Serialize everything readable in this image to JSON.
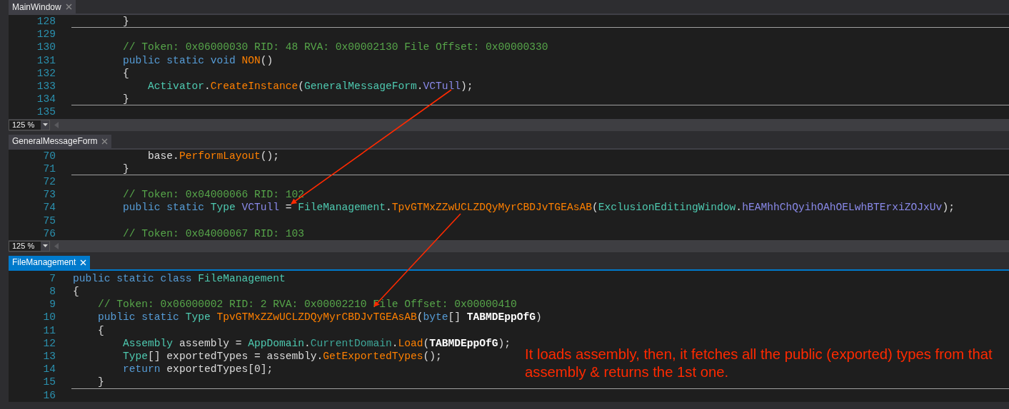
{
  "panels": [
    {
      "tab": {
        "label": "MainWindow",
        "selected": false
      },
      "zoom": "125 %",
      "lines": [
        {
          "number": "128",
          "divider": true,
          "code": [
            {
              "kind": "plain",
              "text": "        }"
            }
          ]
        },
        {
          "number": "129",
          "divider": false
        },
        {
          "number": "130",
          "divider": false,
          "code": [
            {
              "kind": "comment",
              "text": "        // Token: 0x06000030 RID: 48 RVA: 0x00002130 File Offset: 0x00000330"
            }
          ]
        },
        {
          "number": "131",
          "divider": false,
          "code": [
            {
              "kind": "keyword",
              "text": "        public static void "
            },
            {
              "kind": "method",
              "text": "NON"
            },
            {
              "kind": "plain",
              "text": "()"
            }
          ]
        },
        {
          "number": "132",
          "divider": false,
          "code": [
            {
              "kind": "plain",
              "text": "        {"
            }
          ]
        },
        {
          "number": "133",
          "divider": false,
          "code": [
            {
              "kind": "type",
              "text": "            Activator"
            },
            {
              "kind": "plain",
              "text": "."
            },
            {
              "kind": "method",
              "text": "CreateInstance"
            },
            {
              "kind": "plain",
              "text": "("
            },
            {
              "kind": "type",
              "text": "GeneralMessageForm"
            },
            {
              "kind": "plain",
              "text": "."
            },
            {
              "kind": "field",
              "text": "VCTull"
            },
            {
              "kind": "plain",
              "text": ");"
            }
          ]
        },
        {
          "number": "134",
          "divider": true,
          "code": [
            {
              "kind": "plain",
              "text": "        }"
            }
          ]
        },
        {
          "number": "135",
          "divider": false
        }
      ]
    },
    {
      "tab": {
        "label": "GeneralMessageForm",
        "selected": false
      },
      "zoom": "125 %",
      "lines": [
        {
          "number": "70",
          "divider": false,
          "code": [
            {
              "kind": "plain",
              "text": "            base."
            },
            {
              "kind": "method",
              "text": "PerformLayout"
            },
            {
              "kind": "plain",
              "text": "();"
            }
          ]
        },
        {
          "number": "71",
          "divider": true,
          "code": [
            {
              "kind": "plain",
              "text": "        }"
            }
          ]
        },
        {
          "number": "72",
          "divider": false
        },
        {
          "number": "73",
          "divider": false,
          "code": [
            {
              "kind": "comment",
              "text": "        // Token: 0x04000066 RID: 102"
            }
          ]
        },
        {
          "number": "74",
          "divider": false,
          "code": [
            {
              "kind": "keyword",
              "text": "        public static "
            },
            {
              "kind": "type",
              "text": "Type "
            },
            {
              "kind": "field",
              "text": "VCTull"
            },
            {
              "kind": "plain",
              "text": " = "
            },
            {
              "kind": "type",
              "text": "FileManagement"
            },
            {
              "kind": "plain",
              "text": "."
            },
            {
              "kind": "method",
              "text": "TpvGTMxZZwUCLZDQyMyrCBDJvTGEAsAB"
            },
            {
              "kind": "plain",
              "text": "("
            },
            {
              "kind": "type",
              "text": "ExclusionEditingWindow"
            },
            {
              "kind": "plain",
              "text": "."
            },
            {
              "kind": "field",
              "text": "hEAMhhChQyihOAhOELwhBTErxiZOJxUv"
            },
            {
              "kind": "plain",
              "text": ");"
            }
          ]
        },
        {
          "number": "75",
          "divider": false
        },
        {
          "number": "76",
          "divider": false,
          "code": [
            {
              "kind": "comment",
              "text": "        // Token: 0x04000067 RID: 103"
            }
          ]
        }
      ]
    },
    {
      "tab": {
        "label": "FileManagement",
        "selected": true
      },
      "lines": [
        {
          "number": "7",
          "divider": false,
          "code": [
            {
              "kind": "keyword",
              "text": "public static class "
            },
            {
              "kind": "type",
              "text": "FileManagement"
            }
          ]
        },
        {
          "number": "8",
          "divider": false,
          "code": [
            {
              "kind": "plain",
              "text": "{"
            }
          ]
        },
        {
          "number": "9",
          "divider": false,
          "code": [
            {
              "kind": "comment",
              "text": "    // Token: 0x06000002 RID: 2 RVA: 0x00002210 File Offset: 0x00000410"
            }
          ]
        },
        {
          "number": "10",
          "divider": false,
          "code": [
            {
              "kind": "keyword",
              "text": "    public static "
            },
            {
              "kind": "type",
              "text": "Type "
            },
            {
              "kind": "method",
              "text": "TpvGTMxZZwUCLZDQyMyrCBDJvTGEAsAB"
            },
            {
              "kind": "plain",
              "text": "("
            },
            {
              "kind": "keyword",
              "text": "byte"
            },
            {
              "kind": "plain",
              "text": "[] "
            },
            {
              "kind": "param",
              "text": "TABMDEppOfG"
            },
            {
              "kind": "plain",
              "text": ")"
            }
          ]
        },
        {
          "number": "11",
          "divider": false,
          "code": [
            {
              "kind": "plain",
              "text": "    {"
            }
          ]
        },
        {
          "number": "12",
          "divider": false,
          "code": [
            {
              "kind": "type",
              "text": "        Assembly"
            },
            {
              "kind": "plain",
              "text": " assembly = "
            },
            {
              "kind": "type",
              "text": "AppDomain"
            },
            {
              "kind": "plain",
              "text": "."
            },
            {
              "kind": "property",
              "text": "CurrentDomain"
            },
            {
              "kind": "plain",
              "text": "."
            },
            {
              "kind": "method",
              "text": "Load"
            },
            {
              "kind": "plain",
              "text": "("
            },
            {
              "kind": "param",
              "text": "TABMDEppOfG"
            },
            {
              "kind": "plain",
              "text": ");"
            }
          ]
        },
        {
          "number": "13",
          "divider": false,
          "code": [
            {
              "kind": "type",
              "text": "        Type"
            },
            {
              "kind": "plain",
              "text": "[] exportedTypes = assembly."
            },
            {
              "kind": "method",
              "text": "GetExportedTypes"
            },
            {
              "kind": "plain",
              "text": "();"
            }
          ]
        },
        {
          "number": "14",
          "divider": false,
          "code": [
            {
              "kind": "keyword",
              "text": "        return"
            },
            {
              "kind": "plain",
              "text": " exportedTypes[0];"
            }
          ]
        },
        {
          "number": "15",
          "divider": true,
          "code": [
            {
              "kind": "plain",
              "text": "    }"
            }
          ]
        },
        {
          "number": "16",
          "divider": false
        }
      ]
    }
  ],
  "annotation": "It loads assembly, then, it fetches all the public (exported) types from that assembly & returns the 1st one."
}
